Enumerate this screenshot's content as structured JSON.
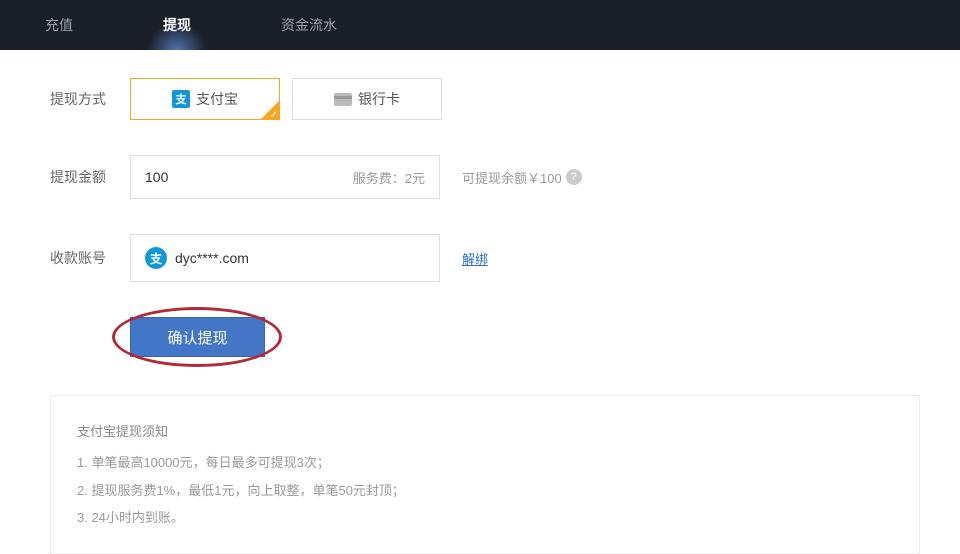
{
  "tabs": [
    "充值",
    "提现",
    "资金流水"
  ],
  "labels": {
    "method": "提现方式",
    "amount": "提现金额",
    "account": "收款账号"
  },
  "methods": {
    "alipay": "支付宝",
    "alipay_glyph": "支",
    "bank": "银行卡"
  },
  "amount": {
    "value": "100",
    "fee": "服务费：2元",
    "balance": "可提现余额￥100"
  },
  "account": {
    "text": "dyc****.com",
    "unbind": "解绑"
  },
  "submit": "确认提现",
  "notice": {
    "title": "支付宝提现须知",
    "items": [
      "1. 单笔最高10000元，每日最多可提现3次；",
      "2. 提现服务费1%，最低1元，向上取整，单笔50元封顶；",
      "3. 24小时内到账。"
    ]
  }
}
